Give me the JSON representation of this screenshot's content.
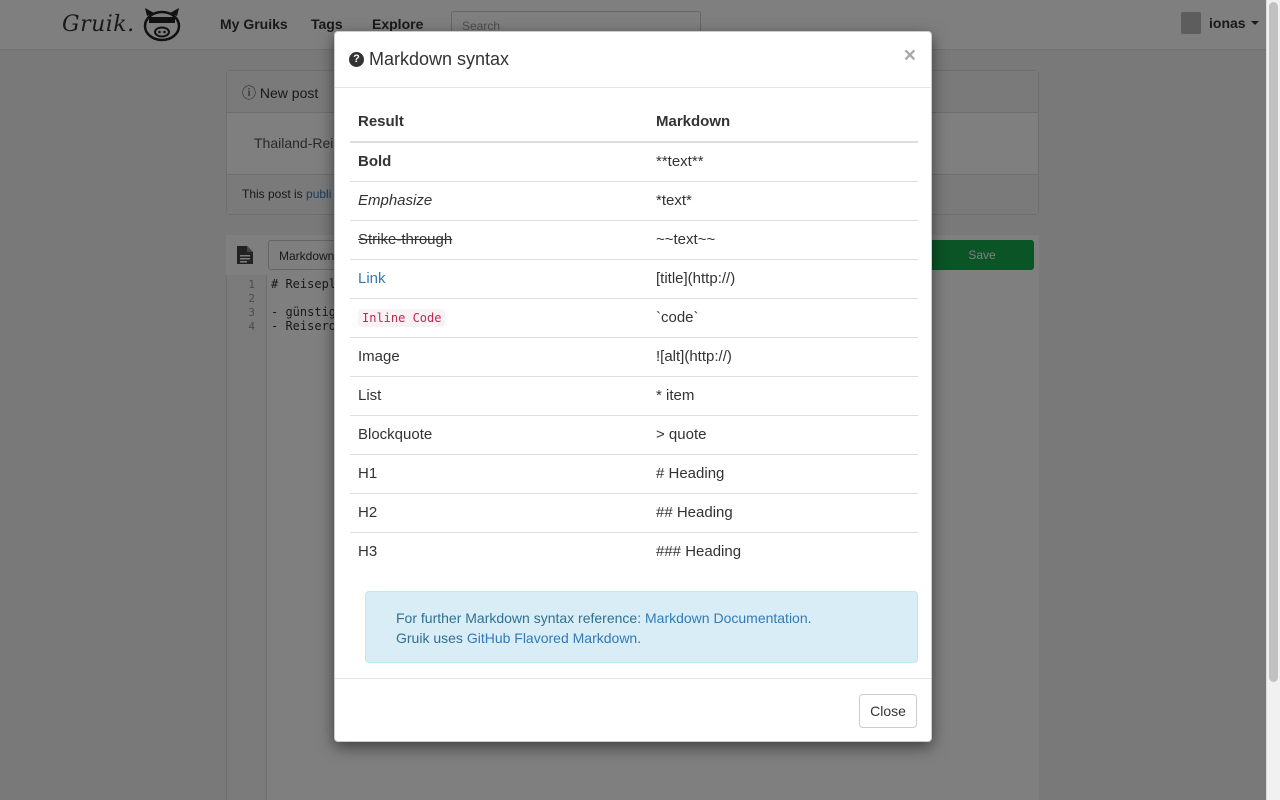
{
  "app": {
    "brand": "Gruik.",
    "nav": [
      "My Gruiks",
      "Tags",
      "Explore"
    ],
    "search_placeholder": "Search",
    "user": "ionas"
  },
  "background": {
    "panel_title": "New post",
    "post_title_value": "Thailand-Reis",
    "visibility_prefix": "This post is",
    "visibility_link": "publi",
    "editor_tab": "Markdown",
    "save_label": "Save",
    "line_numbers": [
      "1",
      "2",
      "3",
      "4"
    ],
    "code_lines": [
      "# Reisepl",
      "",
      "- günstig",
      "- Reisero"
    ]
  },
  "modal": {
    "title": "Markdown syntax",
    "close_x": "×",
    "headers": {
      "result": "Result",
      "markdown": "Markdown"
    },
    "rows": [
      {
        "result": "Bold",
        "markdown": "**text**"
      },
      {
        "result": "Emphasize",
        "markdown": "*text*"
      },
      {
        "result": "Strike-through",
        "markdown": "~~text~~"
      },
      {
        "result": "Link",
        "markdown": "[title](http://)"
      },
      {
        "result": "Inline Code",
        "markdown": "`code`"
      },
      {
        "result": "Image",
        "markdown": "![alt](http://)"
      },
      {
        "result": "List",
        "markdown": "* item"
      },
      {
        "result": "Blockquote",
        "markdown": "> quote"
      },
      {
        "result": "H1",
        "markdown": "# Heading"
      },
      {
        "result": "H2",
        "markdown": "## Heading"
      },
      {
        "result": "H3",
        "markdown": "### Heading"
      }
    ],
    "info": {
      "line1_text": "For further Markdown syntax reference: ",
      "line1_link": "Markdown Documentation",
      "line1_end": ".",
      "line2_text": "Gruik uses ",
      "line2_link": "GitHub Flavored Markdown",
      "line2_end": "."
    },
    "close_button": "Close"
  }
}
